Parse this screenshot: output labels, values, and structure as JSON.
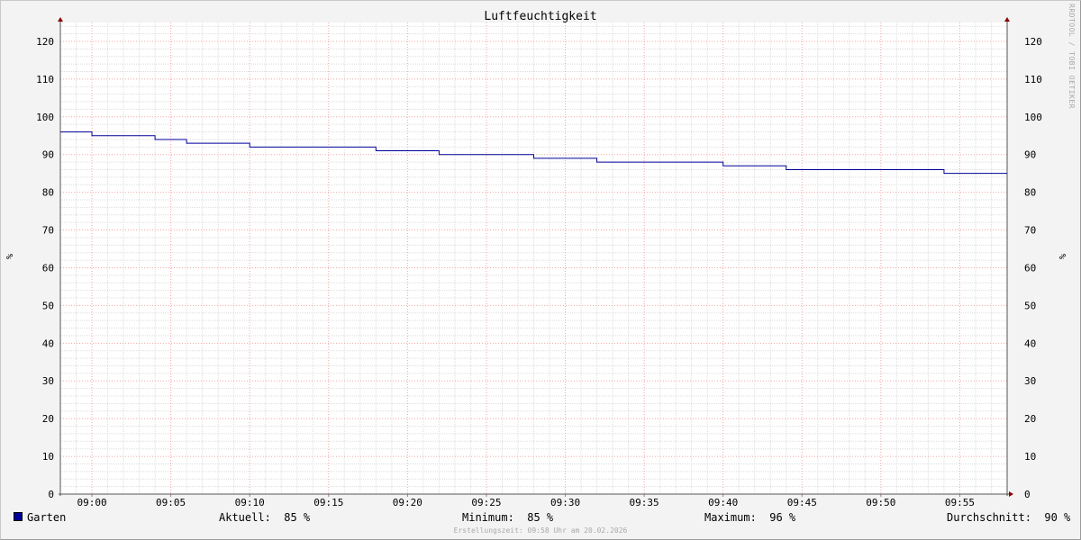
{
  "chart_data": {
    "type": "line",
    "title": "Luftfeuchtigkeit",
    "ylabel_left": "%",
    "ylabel_right": "%",
    "ylim": [
      0,
      125
    ],
    "yticks": [
      0,
      10,
      20,
      30,
      40,
      50,
      60,
      70,
      80,
      90,
      100,
      110,
      120
    ],
    "xrange": [
      "08:58",
      "09:58"
    ],
    "xticks": [
      "09:00",
      "09:05",
      "09:10",
      "09:15",
      "09:20",
      "09:25",
      "09:30",
      "09:35",
      "09:40",
      "09:45",
      "09:50",
      "09:55"
    ],
    "grid": true,
    "step": true,
    "series": [
      {
        "name": "Garten",
        "color": "#000099",
        "x": [
          "08:58",
          "09:00",
          "09:04",
          "09:06",
          "09:10",
          "09:12",
          "09:18",
          "09:22",
          "09:28",
          "09:32",
          "09:40",
          "09:44",
          "09:54",
          "09:58"
        ],
        "values": [
          96,
          95,
          94,
          93,
          92,
          92,
          91,
          90,
          89,
          88,
          87,
          86,
          85,
          85
        ]
      }
    ]
  },
  "watermark": "RRDTOOL / TOBI OETIKER",
  "legend": {
    "series_name": "Garten",
    "aktuell_label": "Aktuell:",
    "aktuell_value": "85 %",
    "minimum_label": "Minimum:",
    "minimum_value": "85 %",
    "maximum_label": "Maximum:",
    "maximum_value": "96 %",
    "durchschnitt_label": "Durchschnitt:",
    "durchschnitt_value": "90 %"
  },
  "footer": "Erstellungszeit: 09:58 Uhr am 20.02.2026"
}
